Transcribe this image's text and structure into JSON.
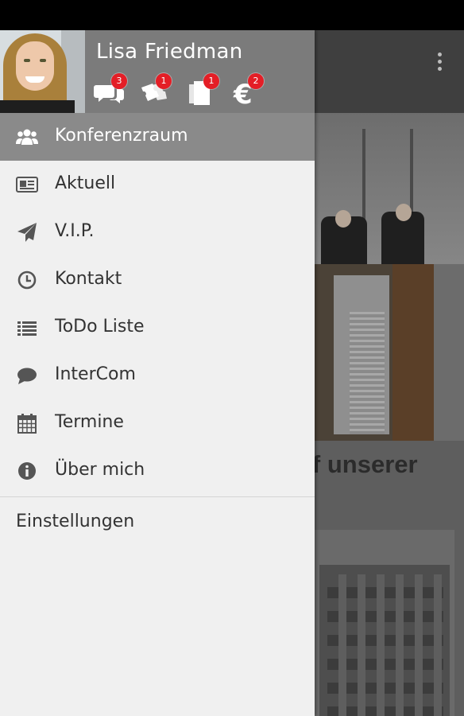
{
  "user": {
    "name": "Lisa Friedman",
    "quick_actions": [
      {
        "icon": "chat-bubbles-icon",
        "badge": "3"
      },
      {
        "icon": "tickets-icon",
        "badge": "1"
      },
      {
        "icon": "documents-icon",
        "badge": "1"
      },
      {
        "icon": "euro-icon",
        "badge": "2"
      }
    ]
  },
  "menu": {
    "items": [
      {
        "label": "Konferenzraum",
        "icon": "group-icon",
        "active": true
      },
      {
        "label": "Aktuell",
        "icon": "newspaper-icon",
        "active": false
      },
      {
        "label": "V.I.P.",
        "icon": "paper-plane-icon",
        "active": false
      },
      {
        "label": "Kontakt",
        "icon": "clock-icon",
        "active": false
      },
      {
        "label": "ToDo Liste",
        "icon": "list-icon",
        "active": false
      },
      {
        "label": "InterCom",
        "icon": "speech-bubble-icon",
        "active": false
      },
      {
        "label": "Termine",
        "icon": "calendar-icon",
        "active": false
      },
      {
        "label": "Über mich",
        "icon": "info-icon",
        "active": false
      }
    ],
    "settings_label": "Einstellungen"
  },
  "background_page": {
    "article_title_fragment": "uf unserer"
  },
  "colors": {
    "drawer_bg": "#f0f0f0",
    "header_bg": "#7b7b7b",
    "active_item_bg": "#8a8a8a",
    "badge_red": "#e41e26",
    "menu_text": "#333333"
  }
}
